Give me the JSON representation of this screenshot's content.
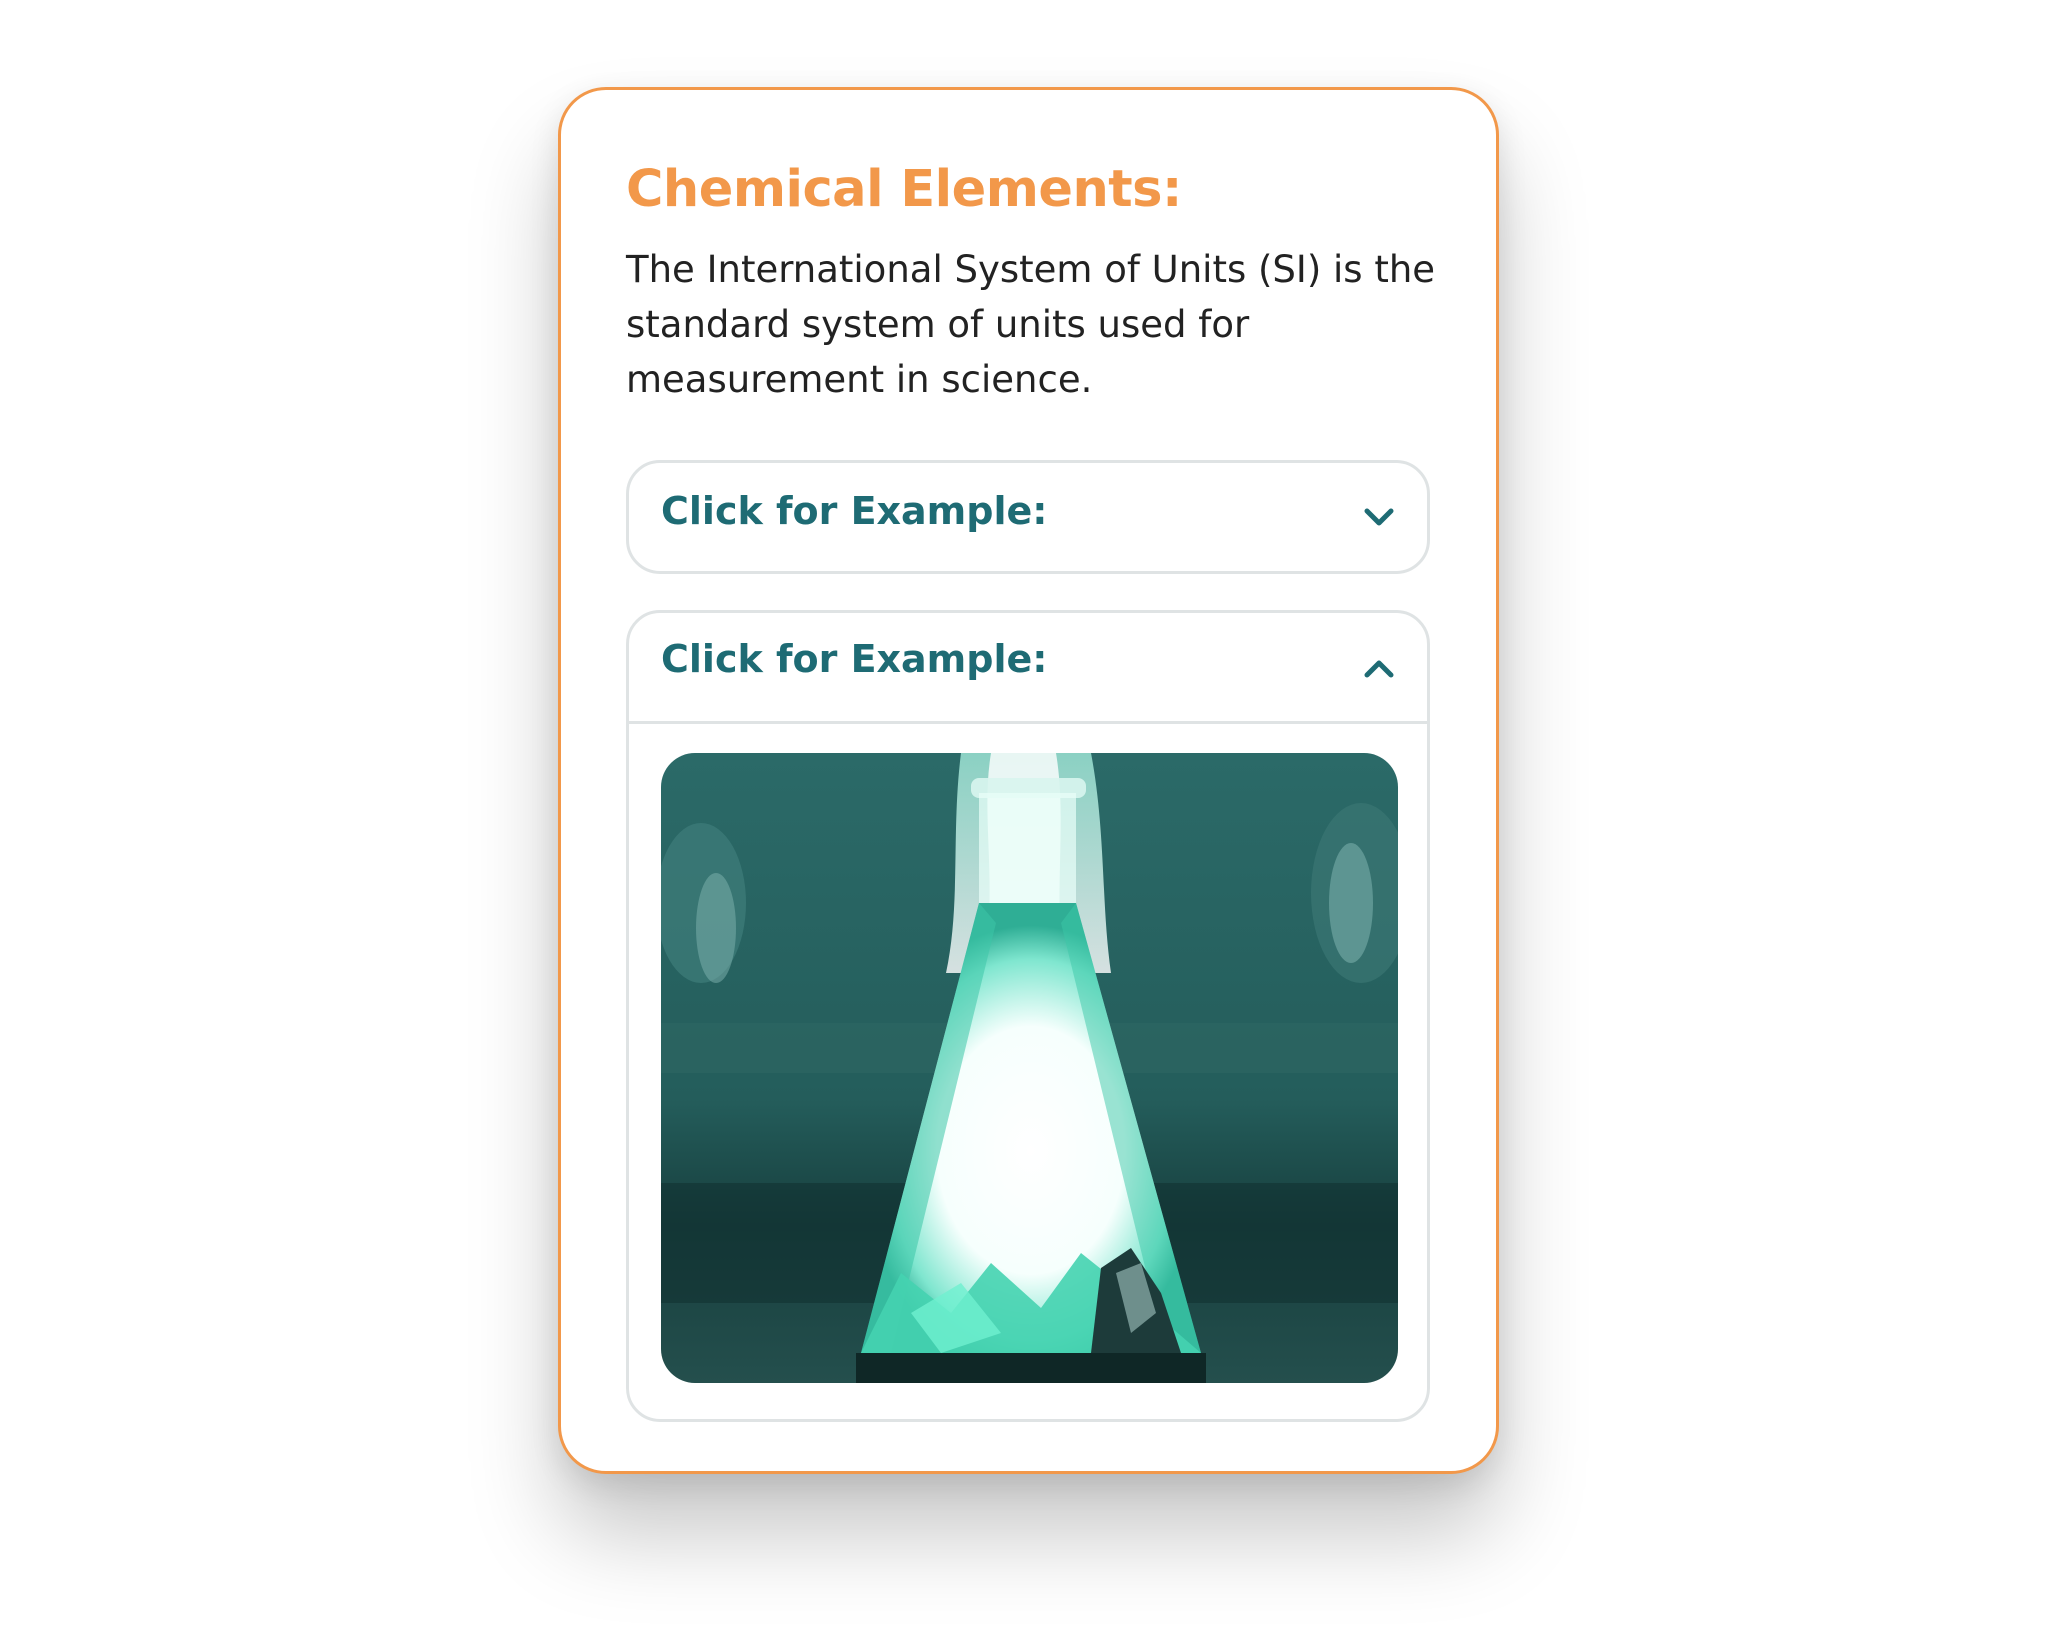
{
  "card": {
    "title": "Chemical Elements:",
    "description": "The International System of Units (SI) is the standard system of units used for measurement in science."
  },
  "accordions": [
    {
      "label": "Click for Example:",
      "state": "collapsed",
      "icon": "chevron-down-icon"
    },
    {
      "label": "Click for Example:",
      "state": "expanded",
      "icon": "chevron-up-icon",
      "media": "erlenmeyer-flask-reaction-image"
    }
  ],
  "colors": {
    "accent": "#f2984a",
    "accordion_label": "#1e6b74",
    "border": "#dfe3e4",
    "text": "#222222"
  }
}
